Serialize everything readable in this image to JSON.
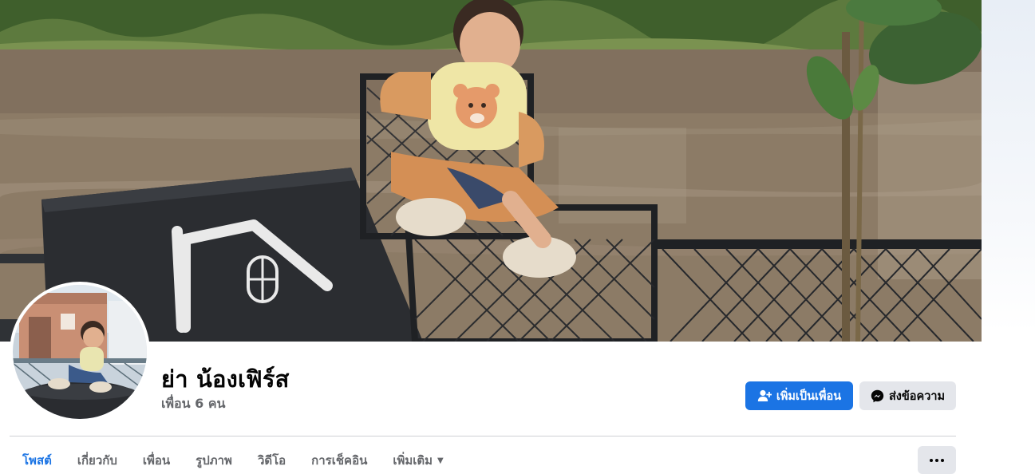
{
  "profile": {
    "name": "ย่า น้องเฟิร์ส",
    "friends_count": "เพื่อน 6 คน"
  },
  "actions": {
    "add_friend_label": "เพิ่มเป็นเพื่อน",
    "message_label": "ส่งข้อความ"
  },
  "tabs": [
    {
      "label": "โพสต์",
      "active": true
    },
    {
      "label": "เกี่ยวกับ",
      "active": false
    },
    {
      "label": "เพื่อน",
      "active": false
    },
    {
      "label": "รูปภาพ",
      "active": false
    },
    {
      "label": "วิดีโอ",
      "active": false
    },
    {
      "label": "การเช็คอิน",
      "active": false
    },
    {
      "label": "เพิ่มเติม",
      "active": false
    }
  ],
  "colors": {
    "accent": "#1b74e4",
    "secondary_button": "#e4e6eb",
    "muted_text": "#65676b"
  }
}
